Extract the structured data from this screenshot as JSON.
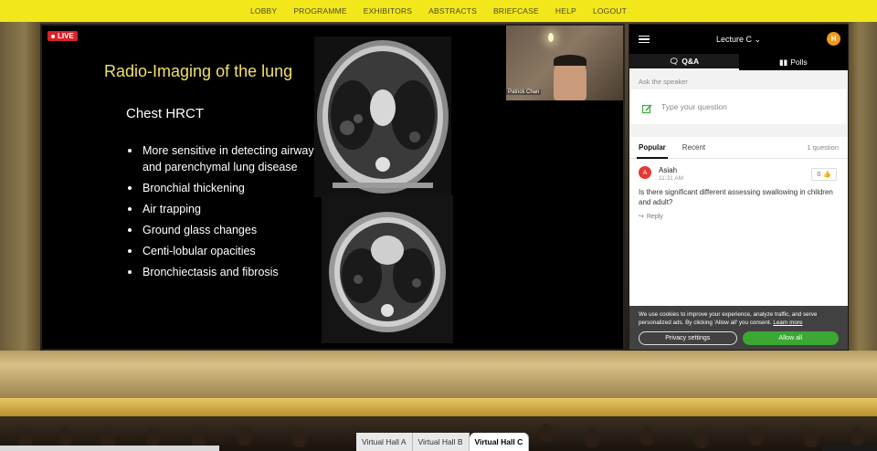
{
  "nav": {
    "items": [
      "LOBBY",
      "PROGRAMME",
      "EXHIBITORS",
      "ABSTRACTS",
      "BRIEFCASE",
      "HELP",
      "LOGOUT"
    ]
  },
  "stream": {
    "live_label": "LIVE",
    "speaker_name": "Patrick Chan",
    "slide": {
      "title": "Radio-Imaging of the lung",
      "subtitle": "Chest HRCT",
      "bullets": [
        "More sensitive in detecting airway and parenchymal lung disease",
        "Bronchial thickening",
        "Air trapping",
        "Ground glass changes",
        "Centi-lobular opacities",
        "Bronchiectasis and fibrosis"
      ]
    }
  },
  "panel": {
    "lecture_title": "Lecture C",
    "user_initial": "H",
    "tabs": {
      "qa": "Q&A",
      "polls": "Polls"
    },
    "ask_label": "Ask the speaker",
    "ask_placeholder": "Type your question",
    "sort_tabs": {
      "popular": "Popular",
      "recent": "Recent"
    },
    "question_count": "1 question",
    "question": {
      "avatar_initial": "A",
      "author": "Asiah",
      "time": "11:31 AM",
      "likes": "0",
      "text": "Is there significant different assessing swallowing in children and adult?",
      "reply_label": "Reply"
    },
    "cookie": {
      "text": "We use cookies to improve your experience, analyze traffic, and serve personalized ads. By clicking 'Allow all' you consent.",
      "link": "Learn more",
      "privacy_button": "Privacy settings",
      "allow_button": "Allow all"
    }
  },
  "halls": [
    "Virtual Hall A",
    "Virtual Hall B",
    "Virtual Hall C"
  ],
  "colors": {
    "nav_bg": "#f2e71a",
    "live_red": "#d8232a",
    "slide_title": "#f0e06a",
    "avatar_orange": "#f09a1a",
    "question_avatar": "#e53935",
    "allow_green": "#3aa832"
  }
}
